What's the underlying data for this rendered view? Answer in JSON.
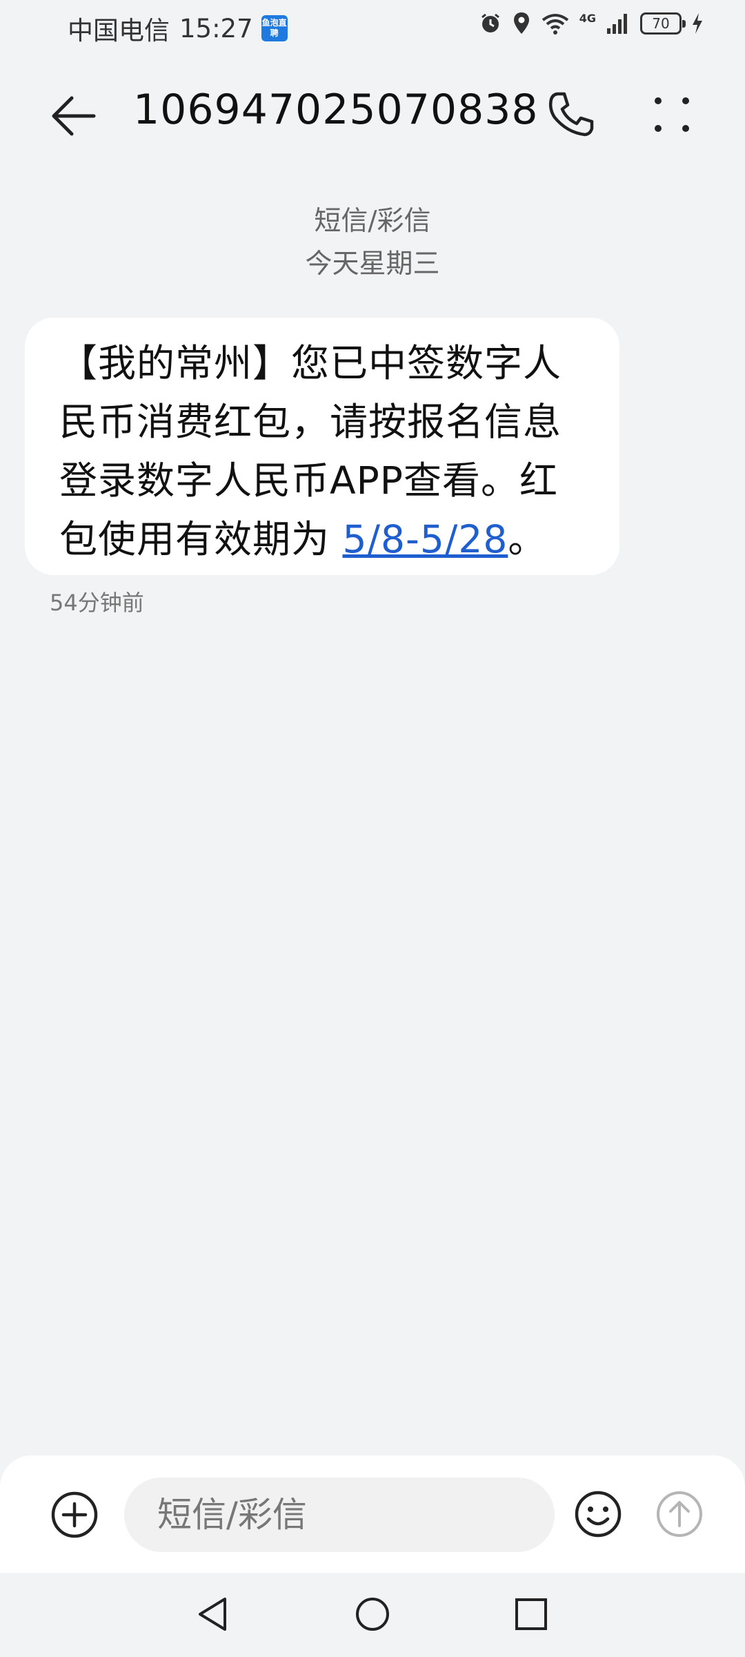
{
  "status_bar": {
    "carrier": "中国电信",
    "time": "15:27",
    "app_badge": "鱼泡直聘",
    "network": "4G",
    "battery": "70"
  },
  "header": {
    "contact_number": "106947025070838"
  },
  "conversation": {
    "channel_label": "短信/彩信",
    "date_label": "今天星期三"
  },
  "message": {
    "text_before_link": "【我的常州】您已中签数字人民币消费红包，请按报名信息登录数字人民币APP查看。红包使用有效期为 ",
    "link_text": "5/8-5/28",
    "text_after_link": "。",
    "timestamp": "54分钟前"
  },
  "compose": {
    "placeholder": "短信/彩信"
  },
  "icons": {
    "back": "back-arrow-icon",
    "call": "phone-icon",
    "more": "more-dots-icon",
    "add": "plus-circle-icon",
    "emoji": "smiley-icon",
    "send": "send-arrow-icon"
  }
}
